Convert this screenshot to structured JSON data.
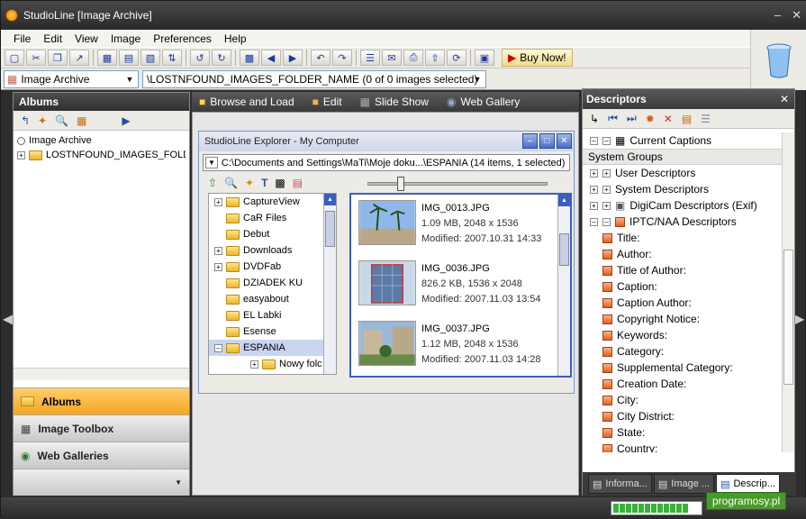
{
  "window": {
    "title": "StudioLine [Image Archive]"
  },
  "menu": [
    "File",
    "Edit",
    "View",
    "Image",
    "Preferences",
    "Help"
  ],
  "toolbar": {
    "buy_now": "Buy Now!"
  },
  "address": {
    "archive": "Image Archive",
    "folder": "\\LOSTNFOUND_IMAGES_FOLDER_NAME (0 of 0 images selected)"
  },
  "left": {
    "header": "Albums",
    "tree": [
      {
        "label": "Image Archive"
      },
      {
        "label": "LOSTNFOUND_IMAGES_FOLDER"
      }
    ],
    "nav": [
      {
        "label": "Albums"
      },
      {
        "label": "Image Toolbox"
      },
      {
        "label": "Web Galleries"
      }
    ]
  },
  "tabs": [
    "Browse and Load",
    "Edit",
    "Slide Show",
    "Web Gallery"
  ],
  "explorer": {
    "title": "StudioLine Explorer - My Computer",
    "path": "C:\\Documents and Settings\\MaTi\\Moje doku...\\ESPANIA  (14 items, 1 selected)",
    "folders": [
      "CaptureView",
      "CaR Files",
      "Debut",
      "Downloads",
      "DVDFab",
      "DZIADEK KU",
      "easyabout",
      "EL Labki",
      "Esense",
      "ESPANIA",
      "Nowy folc"
    ],
    "files": [
      {
        "name": "IMG_0013.JPG",
        "size": "1.09 MB, 2048 x 1536",
        "modified": "Modified: 2007.10.31 14:33"
      },
      {
        "name": "IMG_0036.JPG",
        "size": "826.2 KB, 1536 x 2048",
        "modified": "Modified: 2007.11.03 13:54"
      },
      {
        "name": "IMG_0037.JPG",
        "size": "1.12 MB, 2048 x 1536",
        "modified": "Modified: 2007.11.03 14:28"
      }
    ]
  },
  "descriptors": {
    "header": "Descriptors",
    "current": "Current Captions",
    "group_header": "System Groups",
    "groups": [
      "User Descriptors",
      "System Descriptors",
      "DigiCam Descriptors (Exif)",
      "IPTC/NAA Descriptors"
    ],
    "fields": [
      "Title:",
      "Author:",
      "Title of Author:",
      "Caption:",
      "Caption Author:",
      "Copyright Notice:",
      "Keywords:",
      "Category:",
      "Supplemental Category:",
      "Creation Date:",
      "City:",
      "City District:",
      "State:",
      "Country:"
    ],
    "tabs": [
      "Informa...",
      "Image ...",
      "Descrip..."
    ]
  },
  "watermark": "programosy.pl"
}
